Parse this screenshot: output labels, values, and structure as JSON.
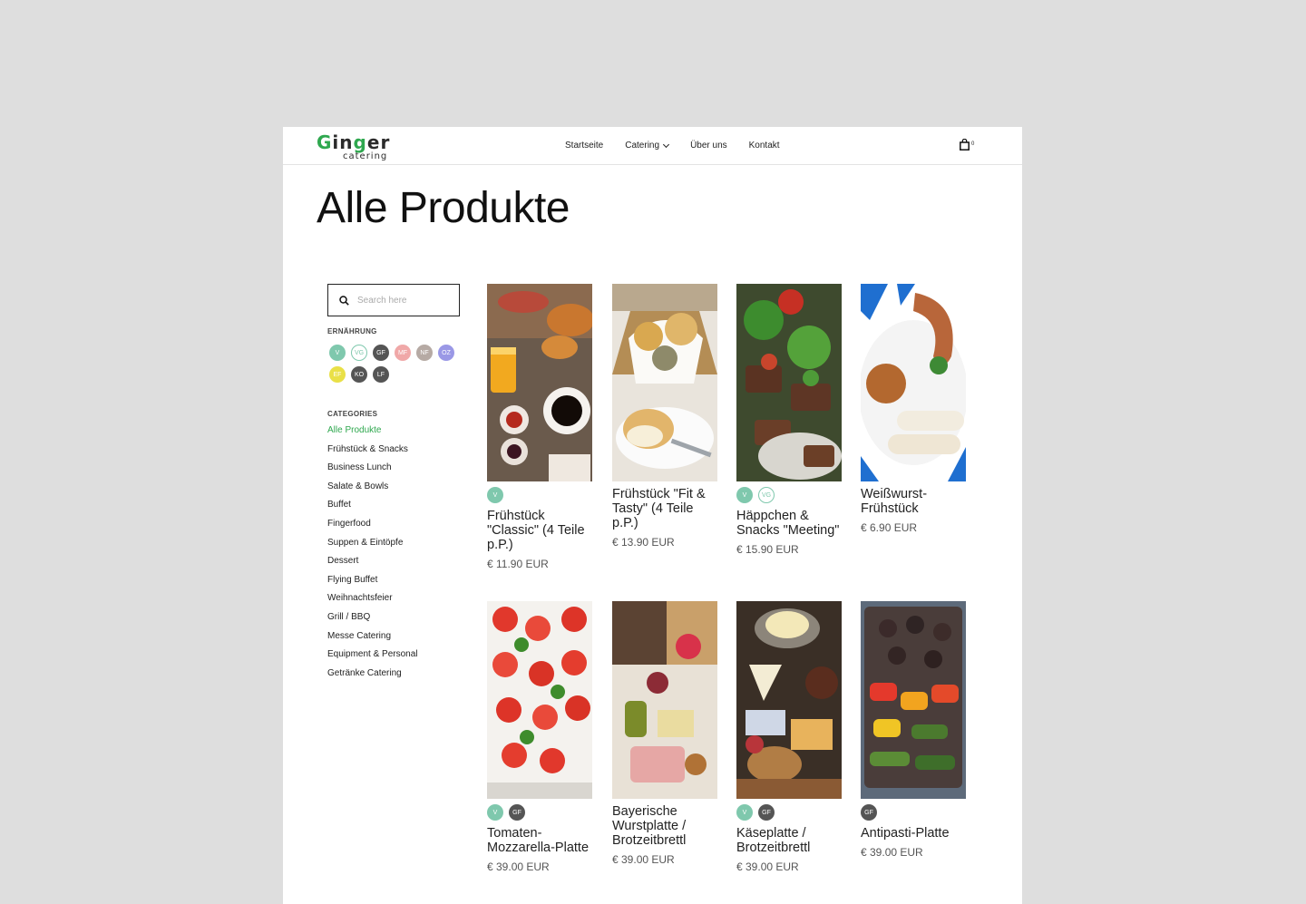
{
  "brand": {
    "logo_main": "Ginger",
    "logo_sub": "catering"
  },
  "nav": {
    "items": [
      "Startseite",
      "Catering",
      "Über uns",
      "Kontakt"
    ],
    "cart_count": "0"
  },
  "page_title": "Alle Produkte",
  "search": {
    "placeholder": "Search here"
  },
  "nutrition": {
    "heading": "ERNÄHRUNG",
    "tags": [
      {
        "label": "V",
        "color": "#7fc8ad"
      },
      {
        "label": "VG",
        "color": "#7fc8ad",
        "outline": true
      },
      {
        "label": "GF",
        "color": "#555555"
      },
      {
        "label": "MF",
        "color": "#f0a8a8"
      },
      {
        "label": "NF",
        "color": "#b6aaa4"
      },
      {
        "label": "OZ",
        "color": "#9a98e6"
      },
      {
        "label": "EF",
        "color": "#e9e047"
      },
      {
        "label": "KO",
        "color": "#555555"
      },
      {
        "label": "LF",
        "color": "#555555"
      }
    ]
  },
  "categories": {
    "heading": "CATEGORIES",
    "items": [
      "Alle Produkte",
      "Frühstück & Snacks",
      "Business Lunch",
      "Salate & Bowls",
      "Buffet",
      "Fingerfood",
      "Suppen & Eintöpfe",
      "Dessert",
      "Flying Buffet",
      "Weihnachtsfeier",
      "Grill / BBQ",
      "Messe Catering",
      "Equipment & Personal",
      "Getränke Catering"
    ]
  },
  "products": [
    {
      "name": "Frühstück \"Classic\" (4 Teile p.P.)",
      "price": "€ 11.90 EUR",
      "badges": [
        "V"
      ]
    },
    {
      "name": "Frühstück \"Fit & Tasty\" (4 Teile p.P.)",
      "price": "€ 13.90 EUR",
      "badges": []
    },
    {
      "name": "Häppchen & Snacks \"Meeting\"",
      "price": "€ 15.90 EUR",
      "badges": [
        "V",
        "VG"
      ]
    },
    {
      "name": "Weißwurst-Frühstück",
      "price": "€ 6.90 EUR",
      "badges": []
    },
    {
      "name": "Tomaten-Mozzarella-Platte",
      "price": "€ 39.00 EUR",
      "badges": [
        "V",
        "GF"
      ]
    },
    {
      "name": "Bayerische Wurstplatte / Brotzeitbrettl",
      "price": "€ 39.00 EUR",
      "badges": []
    },
    {
      "name": "Käseplatte / Brotzeitbrettl",
      "price": "€ 39.00 EUR",
      "badges": [
        "V",
        "GF"
      ]
    },
    {
      "name": "Antipasti-Platte",
      "price": "€ 39.00 EUR",
      "badges": [
        "GF"
      ]
    }
  ],
  "colors": {
    "accent": "#2fa84f",
    "badge_v": "#7fc8ad",
    "badge_gf": "#555555"
  },
  "icons": {
    "search": "search-icon",
    "cart": "shopping-bag-icon",
    "chevron": "chevron-down-icon"
  }
}
